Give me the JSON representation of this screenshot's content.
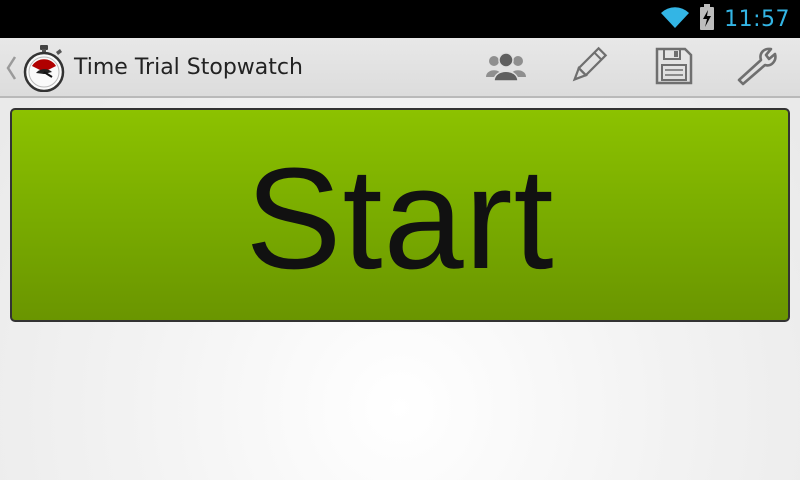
{
  "status_bar": {
    "time": "11:57",
    "icons": [
      "wifi-icon",
      "battery-charging-icon"
    ],
    "accent_color": "#33b5e5"
  },
  "action_bar": {
    "title": "Time Trial Stopwatch",
    "app_icon": "stopwatch-icon",
    "actions": [
      {
        "icon": "people-icon"
      },
      {
        "icon": "pencil-icon"
      },
      {
        "icon": "save-icon"
      },
      {
        "icon": "wrench-icon"
      }
    ]
  },
  "main": {
    "start_label": "Start",
    "start_color": "#7ab000"
  }
}
